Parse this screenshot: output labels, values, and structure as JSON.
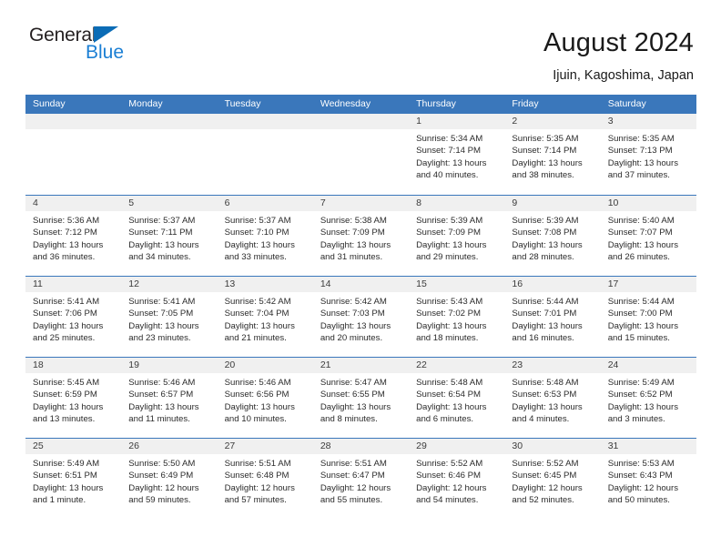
{
  "brand": {
    "name_top": "General",
    "name_bottom": "Blue",
    "triangle_color": "#0b6cb6",
    "blue_color": "#1b7fd4"
  },
  "header": {
    "title": "August 2024",
    "subtitle": "Ijuin, Kagoshima, Japan"
  },
  "theme": {
    "header_blue": "#3a77bb",
    "daynum_band": "#f0f0f0",
    "text": "#2b2b2b"
  },
  "labels": {
    "sunrise": "Sunrise:",
    "sunset": "Sunset:",
    "daylight": "Daylight:"
  },
  "weekdays": [
    "Sunday",
    "Monday",
    "Tuesday",
    "Wednesday",
    "Thursday",
    "Friday",
    "Saturday"
  ],
  "weeks": [
    [
      {
        "day": "",
        "empty": true
      },
      {
        "day": "",
        "empty": true
      },
      {
        "day": "",
        "empty": true
      },
      {
        "day": "",
        "empty": true
      },
      {
        "day": "1",
        "sunrise": "Sunrise: 5:34 AM",
        "sunset": "Sunset: 7:14 PM",
        "daylight_l1": "Daylight: 13 hours",
        "daylight_l2": "and 40 minutes."
      },
      {
        "day": "2",
        "sunrise": "Sunrise: 5:35 AM",
        "sunset": "Sunset: 7:14 PM",
        "daylight_l1": "Daylight: 13 hours",
        "daylight_l2": "and 38 minutes."
      },
      {
        "day": "3",
        "sunrise": "Sunrise: 5:35 AM",
        "sunset": "Sunset: 7:13 PM",
        "daylight_l1": "Daylight: 13 hours",
        "daylight_l2": "and 37 minutes."
      }
    ],
    [
      {
        "day": "4",
        "sunrise": "Sunrise: 5:36 AM",
        "sunset": "Sunset: 7:12 PM",
        "daylight_l1": "Daylight: 13 hours",
        "daylight_l2": "and 36 minutes."
      },
      {
        "day": "5",
        "sunrise": "Sunrise: 5:37 AM",
        "sunset": "Sunset: 7:11 PM",
        "daylight_l1": "Daylight: 13 hours",
        "daylight_l2": "and 34 minutes."
      },
      {
        "day": "6",
        "sunrise": "Sunrise: 5:37 AM",
        "sunset": "Sunset: 7:10 PM",
        "daylight_l1": "Daylight: 13 hours",
        "daylight_l2": "and 33 minutes."
      },
      {
        "day": "7",
        "sunrise": "Sunrise: 5:38 AM",
        "sunset": "Sunset: 7:09 PM",
        "daylight_l1": "Daylight: 13 hours",
        "daylight_l2": "and 31 minutes."
      },
      {
        "day": "8",
        "sunrise": "Sunrise: 5:39 AM",
        "sunset": "Sunset: 7:09 PM",
        "daylight_l1": "Daylight: 13 hours",
        "daylight_l2": "and 29 minutes."
      },
      {
        "day": "9",
        "sunrise": "Sunrise: 5:39 AM",
        "sunset": "Sunset: 7:08 PM",
        "daylight_l1": "Daylight: 13 hours",
        "daylight_l2": "and 28 minutes."
      },
      {
        "day": "10",
        "sunrise": "Sunrise: 5:40 AM",
        "sunset": "Sunset: 7:07 PM",
        "daylight_l1": "Daylight: 13 hours",
        "daylight_l2": "and 26 minutes."
      }
    ],
    [
      {
        "day": "11",
        "sunrise": "Sunrise: 5:41 AM",
        "sunset": "Sunset: 7:06 PM",
        "daylight_l1": "Daylight: 13 hours",
        "daylight_l2": "and 25 minutes."
      },
      {
        "day": "12",
        "sunrise": "Sunrise: 5:41 AM",
        "sunset": "Sunset: 7:05 PM",
        "daylight_l1": "Daylight: 13 hours",
        "daylight_l2": "and 23 minutes."
      },
      {
        "day": "13",
        "sunrise": "Sunrise: 5:42 AM",
        "sunset": "Sunset: 7:04 PM",
        "daylight_l1": "Daylight: 13 hours",
        "daylight_l2": "and 21 minutes."
      },
      {
        "day": "14",
        "sunrise": "Sunrise: 5:42 AM",
        "sunset": "Sunset: 7:03 PM",
        "daylight_l1": "Daylight: 13 hours",
        "daylight_l2": "and 20 minutes."
      },
      {
        "day": "15",
        "sunrise": "Sunrise: 5:43 AM",
        "sunset": "Sunset: 7:02 PM",
        "daylight_l1": "Daylight: 13 hours",
        "daylight_l2": "and 18 minutes."
      },
      {
        "day": "16",
        "sunrise": "Sunrise: 5:44 AM",
        "sunset": "Sunset: 7:01 PM",
        "daylight_l1": "Daylight: 13 hours",
        "daylight_l2": "and 16 minutes."
      },
      {
        "day": "17",
        "sunrise": "Sunrise: 5:44 AM",
        "sunset": "Sunset: 7:00 PM",
        "daylight_l1": "Daylight: 13 hours",
        "daylight_l2": "and 15 minutes."
      }
    ],
    [
      {
        "day": "18",
        "sunrise": "Sunrise: 5:45 AM",
        "sunset": "Sunset: 6:59 PM",
        "daylight_l1": "Daylight: 13 hours",
        "daylight_l2": "and 13 minutes."
      },
      {
        "day": "19",
        "sunrise": "Sunrise: 5:46 AM",
        "sunset": "Sunset: 6:57 PM",
        "daylight_l1": "Daylight: 13 hours",
        "daylight_l2": "and 11 minutes."
      },
      {
        "day": "20",
        "sunrise": "Sunrise: 5:46 AM",
        "sunset": "Sunset: 6:56 PM",
        "daylight_l1": "Daylight: 13 hours",
        "daylight_l2": "and 10 minutes."
      },
      {
        "day": "21",
        "sunrise": "Sunrise: 5:47 AM",
        "sunset": "Sunset: 6:55 PM",
        "daylight_l1": "Daylight: 13 hours",
        "daylight_l2": "and 8 minutes."
      },
      {
        "day": "22",
        "sunrise": "Sunrise: 5:48 AM",
        "sunset": "Sunset: 6:54 PM",
        "daylight_l1": "Daylight: 13 hours",
        "daylight_l2": "and 6 minutes."
      },
      {
        "day": "23",
        "sunrise": "Sunrise: 5:48 AM",
        "sunset": "Sunset: 6:53 PM",
        "daylight_l1": "Daylight: 13 hours",
        "daylight_l2": "and 4 minutes."
      },
      {
        "day": "24",
        "sunrise": "Sunrise: 5:49 AM",
        "sunset": "Sunset: 6:52 PM",
        "daylight_l1": "Daylight: 13 hours",
        "daylight_l2": "and 3 minutes."
      }
    ],
    [
      {
        "day": "25",
        "sunrise": "Sunrise: 5:49 AM",
        "sunset": "Sunset: 6:51 PM",
        "daylight_l1": "Daylight: 13 hours",
        "daylight_l2": "and 1 minute."
      },
      {
        "day": "26",
        "sunrise": "Sunrise: 5:50 AM",
        "sunset": "Sunset: 6:49 PM",
        "daylight_l1": "Daylight: 12 hours",
        "daylight_l2": "and 59 minutes."
      },
      {
        "day": "27",
        "sunrise": "Sunrise: 5:51 AM",
        "sunset": "Sunset: 6:48 PM",
        "daylight_l1": "Daylight: 12 hours",
        "daylight_l2": "and 57 minutes."
      },
      {
        "day": "28",
        "sunrise": "Sunrise: 5:51 AM",
        "sunset": "Sunset: 6:47 PM",
        "daylight_l1": "Daylight: 12 hours",
        "daylight_l2": "and 55 minutes."
      },
      {
        "day": "29",
        "sunrise": "Sunrise: 5:52 AM",
        "sunset": "Sunset: 6:46 PM",
        "daylight_l1": "Daylight: 12 hours",
        "daylight_l2": "and 54 minutes."
      },
      {
        "day": "30",
        "sunrise": "Sunrise: 5:52 AM",
        "sunset": "Sunset: 6:45 PM",
        "daylight_l1": "Daylight: 12 hours",
        "daylight_l2": "and 52 minutes."
      },
      {
        "day": "31",
        "sunrise": "Sunrise: 5:53 AM",
        "sunset": "Sunset: 6:43 PM",
        "daylight_l1": "Daylight: 12 hours",
        "daylight_l2": "and 50 minutes."
      }
    ]
  ]
}
